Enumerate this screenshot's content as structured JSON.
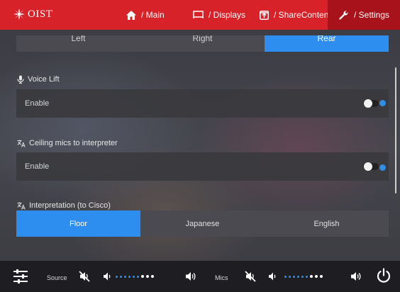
{
  "header": {
    "logo_text": "OIST",
    "nav": [
      {
        "label": "/ Main",
        "icon": "home-icon"
      },
      {
        "label": "/ Displays",
        "icon": "display-icon"
      },
      {
        "label": "/ ShareContent",
        "icon": "share-content-icon"
      },
      {
        "label": "/ Settings",
        "icon": "wrench-icon",
        "active": true
      }
    ]
  },
  "content": {
    "partial_tabs": [
      "Left",
      "Right",
      "Rear"
    ],
    "partial_tabs_active": "Rear",
    "voice_lift": {
      "title": "Voice Lift",
      "row_label": "Enable",
      "enabled": false
    },
    "ceiling_mics": {
      "title": "Ceiling mics to interpreter",
      "row_label": "Enable",
      "enabled": false
    },
    "interpretation": {
      "title": "Interpretation (to Cisco)",
      "options": [
        "Floor",
        "Japanese",
        "English"
      ],
      "selected": "Floor"
    }
  },
  "footer": {
    "source_label": "Source",
    "mics_label": "Mics",
    "source_level_active_dots": 6,
    "source_level_total_dots": 9,
    "mics_level_active_dots": 6,
    "mics_level_total_dots": 9
  },
  "colors": {
    "header_red": "#d8222a",
    "active_tab_red": "#a8121a",
    "accent_blue": "#2d8ef0",
    "bottom_bar": "#1e1e22"
  }
}
